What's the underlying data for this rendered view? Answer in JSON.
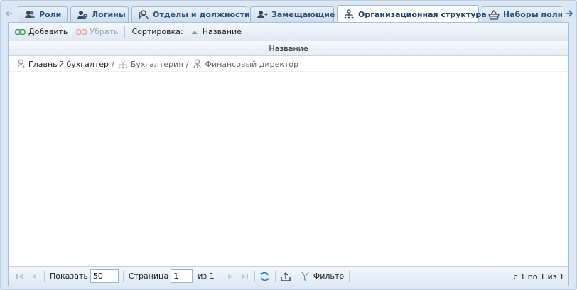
{
  "tabs": [
    {
      "label": "Роли",
      "icon": "users-icon",
      "active": false
    },
    {
      "label": "Логины",
      "icon": "user-key-icon",
      "active": false
    },
    {
      "label": "Отделы и должности",
      "icon": "org-unit-icon",
      "active": false
    },
    {
      "label": "Замещающие",
      "icon": "substitute-icon",
      "active": false
    },
    {
      "label": "Организационная структура",
      "icon": "hierarchy-icon",
      "active": true
    },
    {
      "label": "Наборы полн",
      "icon": "basket-icon",
      "active": false
    }
  ],
  "toolbar": {
    "add_label": "Добавить",
    "remove_label": "Убрать",
    "sort_label": "Сортировка:",
    "sort_field": "Название"
  },
  "grid": {
    "header": "Название",
    "row": {
      "parts": [
        {
          "label": "Главный бухгалтер",
          "icon": "position-icon"
        },
        {
          "label": "Бухгалтерия",
          "icon": "department-icon"
        },
        {
          "label": "Финансовый директор",
          "icon": "position-icon"
        }
      ]
    }
  },
  "paging": {
    "show_label": "Показать",
    "page_size": "50",
    "page_label": "Страница",
    "page_value": "1",
    "of_label": "из 1",
    "filter_label": "Фильтр",
    "display_msg": "с 1 по 1 из 1"
  },
  "colors": {
    "frame_bg": "#dde8f4",
    "tab_text": "#2c4f7c",
    "accent": "#3a78b8"
  }
}
